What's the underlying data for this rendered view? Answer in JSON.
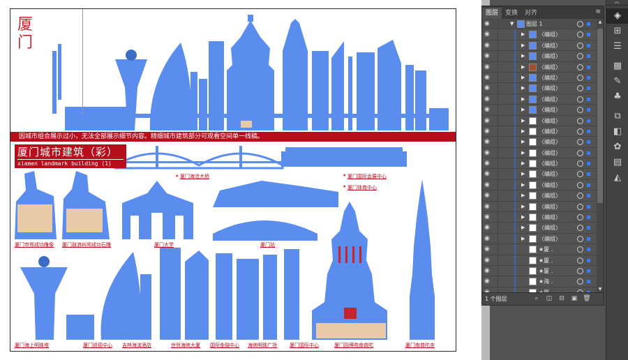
{
  "artboard": {
    "title_chars": "厦门",
    "notice_text": "因城市组合展示过小，无法全部展示细节内容。精细城市建筑部分可观看空间单一线稿。",
    "heading_cn": "厦门城市建筑（彩）",
    "heading_en": "xiamen landmark building (1)",
    "captions_mid": [
      "厦门海沧大桥",
      "厦门国际会展中心",
      "厦门体育中心"
    ],
    "captions_row2": [
      "厦门市郑成功雕像",
      "厦门鼓浪屿郑成功石雕",
      "厦门大学",
      "厦门站"
    ],
    "captions_bottom": [
      "厦门海上明珠塔",
      "厦门凯德中心",
      "吉林海滨酒店",
      "世贸海峡大厦",
      "国际金融中心",
      "海峡明珠广场",
      "厦门国际中心",
      "厦门园博苑南普陀",
      "厦门南普陀寺"
    ],
    "colors": {
      "building": "#5b8def",
      "accent_red": "#b80d1b",
      "beige": "#e8c9a8"
    }
  },
  "layers_panel": {
    "tabs": [
      "图层",
      "变换",
      "对齐"
    ],
    "active_tab": "图层",
    "menu_icon": "panel-menu-icon",
    "top_layer": {
      "name": "图层 1",
      "thumb_icon": "layer-thumbnail-icon"
    },
    "rows": [
      {
        "name": "〈编组〉",
        "thumb": "blue"
      },
      {
        "name": "〈编组〉",
        "thumb": "blue"
      },
      {
        "name": "〈编组〉",
        "thumb": "blue"
      },
      {
        "name": "〈编组〉",
        "thumb": "brown"
      },
      {
        "name": "〈编组〉",
        "thumb": "blue"
      },
      {
        "name": "〈编组〉",
        "thumb": "blue"
      },
      {
        "name": "〈编组〉",
        "thumb": "blue"
      },
      {
        "name": "〈编组〉",
        "thumb": "blue"
      },
      {
        "name": "〈编组〉",
        "thumb": "white"
      },
      {
        "name": "〈编组〉",
        "thumb": "white"
      },
      {
        "name": "〈编组〉",
        "thumb": "white"
      },
      {
        "name": "〈编组〉",
        "thumb": "white"
      },
      {
        "name": "〈编组〉",
        "thumb": "white"
      },
      {
        "name": "〈编组〉",
        "thumb": "white"
      },
      {
        "name": "〈编组〉",
        "thumb": "white"
      },
      {
        "name": "〈编组〉",
        "thumb": "white"
      },
      {
        "name": "〈编组〉",
        "thumb": "white"
      },
      {
        "name": "〈编组〉",
        "thumb": "white"
      },
      {
        "name": "〈编组〉",
        "thumb": "white"
      },
      {
        "name": "〈编组〉",
        "thumb": "white"
      },
      {
        "name": "★厦 .",
        "thumb": "white"
      },
      {
        "name": "★厦 .",
        "thumb": "white"
      },
      {
        "name": "★厦 .",
        "thumb": "white"
      },
      {
        "name": "★海 .",
        "thumb": "white"
      },
      {
        "name": "★厦 .",
        "thumb": "white"
      }
    ],
    "footer": {
      "count_label": "1 个图层",
      "icons": [
        "locate-object-icon",
        "make-clipping-mask-icon",
        "create-sublayer-icon",
        "new-layer-icon",
        "delete-layer-icon"
      ]
    }
  },
  "right_toolbar": {
    "icons": [
      "layers-icon",
      "artboards-icon",
      "align-icon",
      "swatches-icon",
      "brushes-icon",
      "symbols-icon",
      "transform-icon",
      "pathfinder-icon",
      "color-guide-icon",
      "gradient-icon",
      "transparency-icon"
    ]
  }
}
